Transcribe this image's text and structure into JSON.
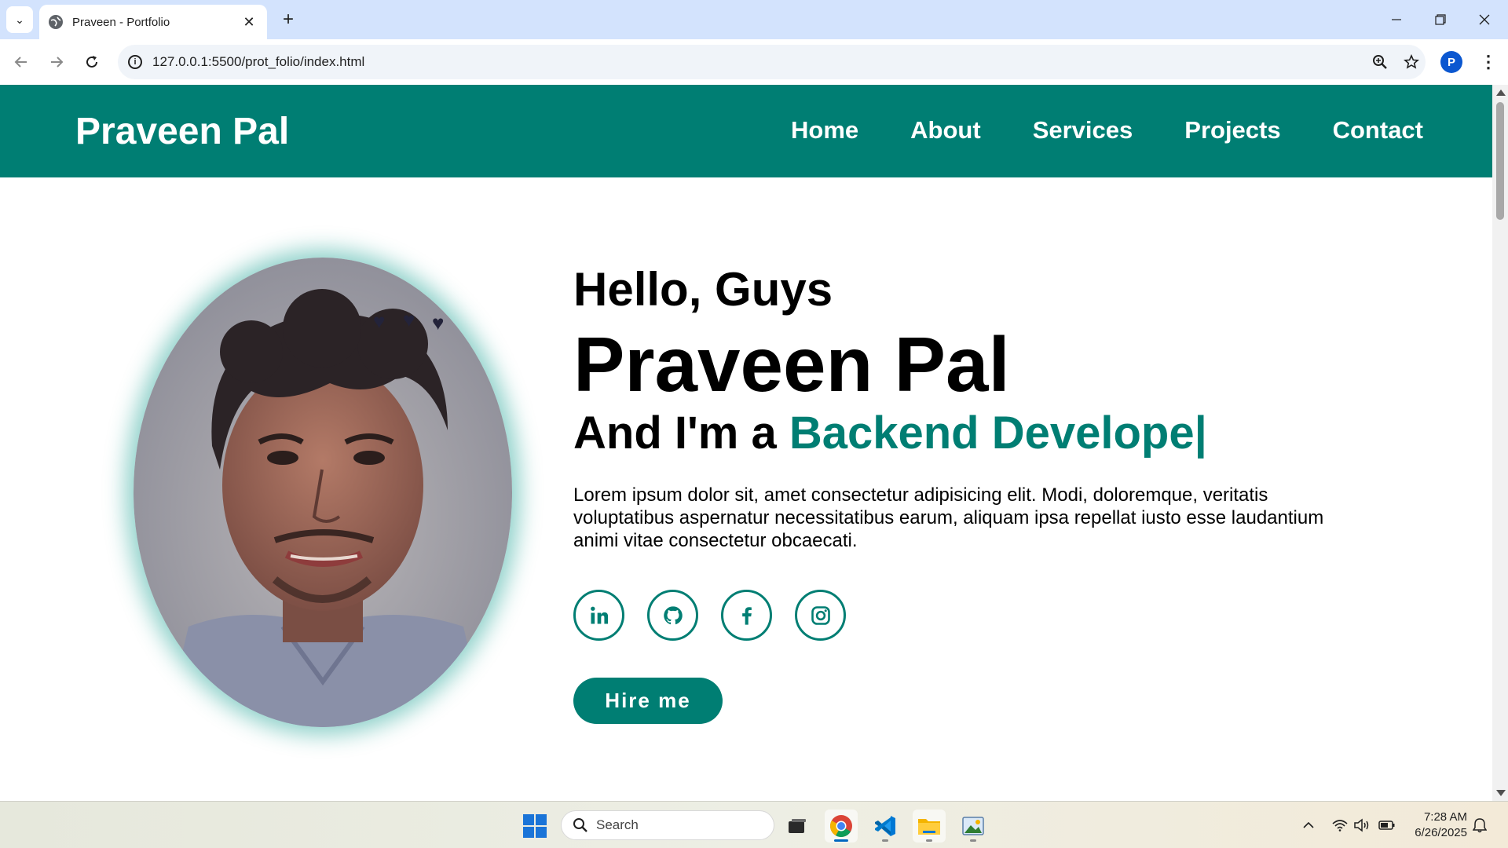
{
  "browser": {
    "tab_title": "Praveen - Portfolio",
    "tab_close": "✕",
    "new_tab": "+",
    "url": "127.0.0.1:5500/prot_folio/index.html",
    "profile_initial": "P"
  },
  "header": {
    "logo": "Praveen Pal",
    "nav": [
      "Home",
      "About",
      "Services",
      "Projects",
      "Contact"
    ]
  },
  "hero": {
    "greeting": "Hello, Guys",
    "name": "Praveen Pal",
    "role_prefix": "And I'm a ",
    "role": "Backend Develope|",
    "description": "Lorem ipsum dolor sit, amet consectetur adipisicing elit. Modi, doloremque, veritatis voluptatibus aspernatur necessitatibus earum, aliquam ipsa repellat iusto esse laudantium animi vitae consectetur obcaecati.",
    "social_icons": [
      "linkedin-icon",
      "github-icon",
      "facebook-icon",
      "instagram-icon"
    ],
    "hire_button": "Hire me"
  },
  "taskbar": {
    "search_label": "Search",
    "time": "7:28 AM",
    "date": "6/26/2025"
  },
  "colors": {
    "accent": "#007e73",
    "tabbar": "#d3e3fd"
  }
}
